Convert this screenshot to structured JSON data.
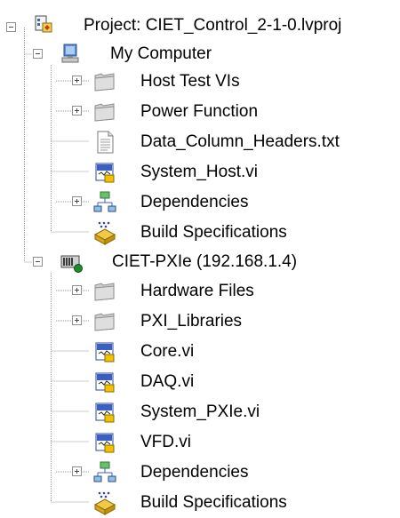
{
  "tree": {
    "root": {
      "label": "Project: CIET_Control_2-1-0.lvproj",
      "icon": "labview-project-icon"
    },
    "my_computer": {
      "label": "My Computer",
      "icon": "computer-icon",
      "items": [
        {
          "label": "Host Test VIs",
          "icon": "folder-icon"
        },
        {
          "label": "Power Function",
          "icon": "folder-icon"
        },
        {
          "label": "Data_Column_Headers.txt",
          "icon": "text-file-icon"
        },
        {
          "label": "System_Host.vi",
          "icon": "vi-file-icon"
        },
        {
          "label": "Dependencies",
          "icon": "dependencies-icon"
        },
        {
          "label": "Build Specifications",
          "icon": "build-spec-icon"
        }
      ]
    },
    "target": {
      "label": "CIET-PXIe (192.168.1.4)",
      "icon": "pxi-target-icon",
      "items": [
        {
          "label": "Hardware Files",
          "icon": "folder-icon"
        },
        {
          "label": "PXI_Libraries",
          "icon": "folder-icon"
        },
        {
          "label": "Core.vi",
          "icon": "vi-file-icon"
        },
        {
          "label": "DAQ.vi",
          "icon": "vi-file-icon"
        },
        {
          "label": "System_PXIe.vi",
          "icon": "vi-file-icon"
        },
        {
          "label": "VFD.vi",
          "icon": "vi-file-icon"
        },
        {
          "label": "Dependencies",
          "icon": "dependencies-icon"
        },
        {
          "label": "Build Specifications",
          "icon": "build-spec-icon"
        }
      ]
    }
  }
}
